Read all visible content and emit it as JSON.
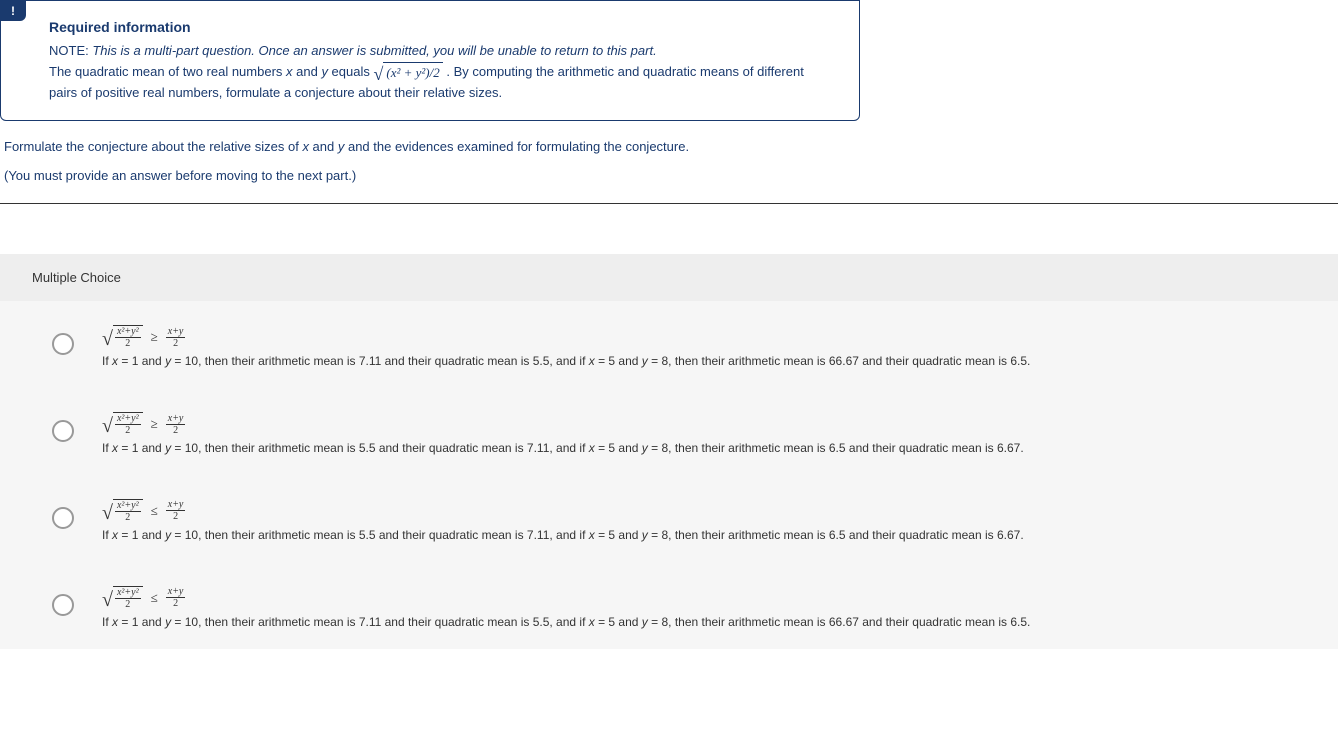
{
  "infoBox": {
    "badge": "!",
    "heading": "Required information",
    "noteLabel": "NOTE:",
    "noteText": "This is a multi-part question. Once an answer is submitted, you will be unable to return to this part.",
    "descPart1": "The quadratic mean of two real numbers ",
    "var1": "x",
    "descPart2": " and ",
    "var2": "y",
    "descPart3": " equals ",
    "formulaRoot": "(x² + y²)/2",
    "descPart4": " . By computing the arithmetic and quadratic means of different pairs of positive real numbers, formulate a conjecture about their relative sizes."
  },
  "prompt": {
    "line1a": "Formulate the conjecture about the relative sizes of ",
    "var1": "x",
    "line1b": " and ",
    "var2": "y",
    "line1c": " and the evidences examined for formulating the conjecture.",
    "line2": "(You must provide an answer before moving to the next part.)"
  },
  "mc": {
    "header": "Multiple Choice",
    "options": [
      {
        "lhsNum": "x²+y²",
        "lhsDen": "2",
        "rel": "≥",
        "rhsNum": "x+y",
        "rhsDen": "2",
        "evidence": "If x = 1 and y = 10, then their arithmetic mean is 7.11 and their quadratic mean is 5.5, and if x = 5 and y = 8, then their arithmetic mean is 66.67 and their quadratic mean is 6.5."
      },
      {
        "lhsNum": "x²+y²",
        "lhsDen": "2",
        "rel": "≥",
        "rhsNum": "x+y",
        "rhsDen": "2",
        "evidence": "If x = 1 and y = 10, then their arithmetic mean is 5.5 and their quadratic mean is 7.11, and if x = 5 and y = 8, then their arithmetic mean is 6.5 and their quadratic mean is 6.67."
      },
      {
        "lhsNum": "x²+y²",
        "lhsDen": "2",
        "rel": "≤",
        "rhsNum": "x+y",
        "rhsDen": "2",
        "evidence": "If x = 1 and y = 10, then their arithmetic mean is 5.5 and their quadratic mean is 7.11, and if x = 5 and y = 8, then their arithmetic mean is 6.5 and their quadratic mean is 6.67."
      },
      {
        "lhsNum": "x²+y²",
        "lhsDen": "2",
        "rel": "≤",
        "rhsNum": "x+y",
        "rhsDen": "2",
        "evidence": "If x = 1 and y = 10, then their arithmetic mean is 7.11 and their quadratic mean is 5.5, and if x = 5 and y = 8, then their arithmetic mean is 66.67 and their quadratic mean is 6.5."
      }
    ]
  }
}
